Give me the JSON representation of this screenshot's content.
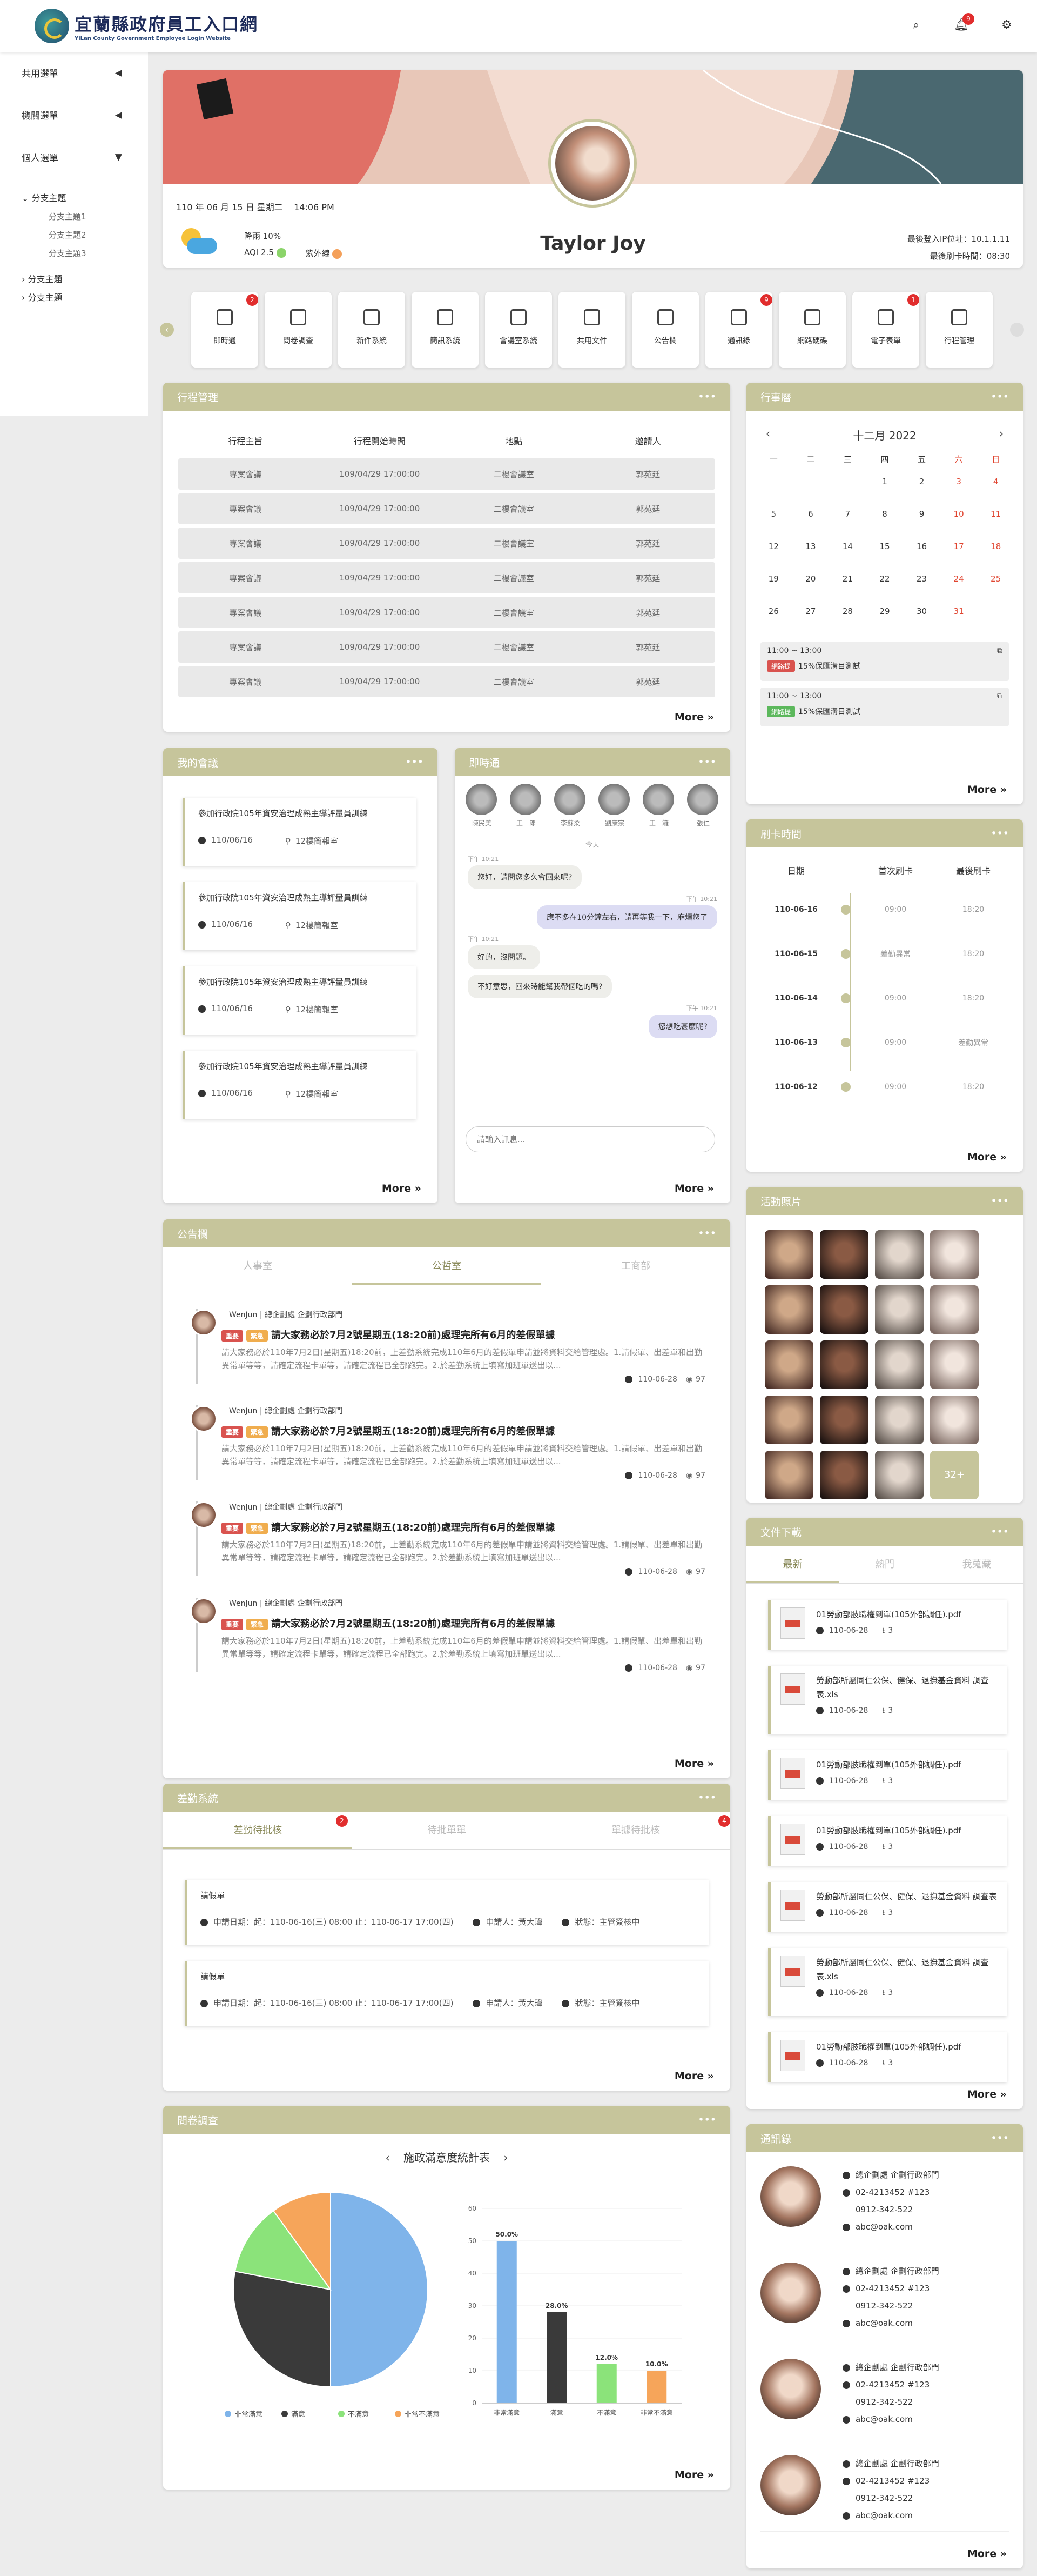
{
  "header": {
    "logo_title": "宜蘭縣政府員工入口網",
    "logo_subtitle": "YiLan County Government Employee Login Website",
    "notif_count": "9"
  },
  "sidebar": {
    "items": [
      {
        "label": "共用選單"
      },
      {
        "label": "機關選單"
      },
      {
        "label": "個人選單"
      }
    ],
    "tree": {
      "root": "分支主題",
      "subs": [
        "分支主題1",
        "分支主題2",
        "分支主題3"
      ],
      "others": [
        "分支主題",
        "分支主題"
      ]
    }
  },
  "profile": {
    "date": "110 年 06 月 15 日 星期二",
    "time": "14:06 PM",
    "rain": "降雨 10%",
    "aqi": "AQI 2.5",
    "uv": "紫外線",
    "name": "Taylor Joy",
    "last_ip": "最後登入IP位址：10.1.1.11",
    "last_punch": "最後刷卡時間：08:30"
  },
  "quick": [
    {
      "label": "即時通",
      "badge": "2",
      "icon": "chat-icon"
    },
    {
      "label": "問卷調查",
      "badge": "",
      "icon": "chart-icon"
    },
    {
      "label": "新件系統",
      "badge": "",
      "icon": "mail-icon"
    },
    {
      "label": "簡訊系統",
      "badge": "",
      "icon": "message-icon"
    },
    {
      "label": "會議室系統",
      "badge": "",
      "icon": "watch-icon"
    },
    {
      "label": "共用文件",
      "badge": "",
      "icon": "document-icon"
    },
    {
      "label": "公告欄",
      "badge": "",
      "icon": "window-icon"
    },
    {
      "label": "通訊錄",
      "badge": "9",
      "icon": "contact-icon"
    },
    {
      "label": "網路硬碟",
      "badge": "",
      "icon": "drive-icon"
    },
    {
      "label": "電子表單",
      "badge": "1",
      "icon": "list-icon"
    },
    {
      "label": "行程管理",
      "badge": "",
      "icon": "calendar-icon"
    }
  ],
  "schedule": {
    "title": "行程管理",
    "headers": [
      "行程主旨",
      "行程開始時間",
      "地點",
      "邀請人"
    ],
    "row": [
      "專案會議",
      "109/04/29 17:00:00",
      "二樓會議室",
      "郭苑廷"
    ],
    "row_count": "7",
    "more": "More"
  },
  "calendar": {
    "title": "行事曆",
    "month": "十二月 2022",
    "weekdays": [
      "一",
      "二",
      "三",
      "四",
      "五",
      "六",
      "日"
    ],
    "weeks": [
      [
        "",
        "",
        "",
        "1",
        "2",
        "3",
        "4"
      ],
      [
        "5",
        "6",
        "7",
        "8",
        "9",
        "10",
        "11"
      ],
      [
        "12",
        "13",
        "14",
        "15",
        "16",
        "17",
        "18"
      ],
      [
        "19",
        "20",
        "21",
        "22",
        "23",
        "24",
        "25"
      ],
      [
        "26",
        "27",
        "28",
        "29",
        "30",
        "31",
        ""
      ]
    ],
    "events": [
      {
        "time": "11:00 ~ 13:00",
        "tag": "網路提",
        "tag_color": "#d9534f",
        "text": "15%保匯溝目測試"
      },
      {
        "time": "11:00 ~ 13:00",
        "tag": "網路提",
        "tag_color": "#5cb85c",
        "text": "15%保匯溝目測試"
      }
    ],
    "more": "More"
  },
  "meetings": {
    "title": "我的會議",
    "item": {
      "title": "參加行政院105年資安治理成熟主導評量員訓練",
      "date": "110/06/16",
      "room": "12樓簡報室"
    },
    "more": "More"
  },
  "chat": {
    "title": "即時通",
    "users": [
      "陳民美",
      "王一郎",
      "李蘇柔",
      "劉康宗",
      "王一籬",
      "張仁"
    ],
    "today": "今天",
    "messages": [
      {
        "side": "left",
        "time": "下午 10:21",
        "text": "您好，請問您多久會回來呢?"
      },
      {
        "side": "right",
        "time": "下午 10:21",
        "text": "應不多在10分鐘左右，請再等我一下，麻煩您了"
      },
      {
        "side": "left",
        "time": "下午 10:21",
        "text": "好的，沒問題。"
      },
      {
        "side": "left",
        "time": "",
        "text": "不好意思，回來時能幫我帶個吃的嗎?"
      },
      {
        "side": "right",
        "time": "下午 10:21",
        "text": "您想吃甚麼呢?"
      }
    ],
    "placeholder": "請輸入訊息...",
    "more": "More"
  },
  "punch": {
    "title": "刷卡時間",
    "headers": [
      "日期",
      "首次刷卡",
      "最後刷卡"
    ],
    "rows": [
      {
        "date": "110-06-16",
        "first": "09:00",
        "last": "18:20"
      },
      {
        "date": "110-06-15",
        "first": "差勤異常",
        "last": "18:20"
      },
      {
        "date": "110-06-14",
        "first": "09:00",
        "last": "18:20"
      },
      {
        "date": "110-06-13",
        "first": "09:00",
        "last": "差勤異常"
      },
      {
        "date": "110-06-12",
        "first": "09:00",
        "last": "18:20"
      }
    ],
    "more": "More"
  },
  "photos": {
    "title": "活動照片",
    "more_count": "32+"
  },
  "announce": {
    "title": "公告欄",
    "tabs": [
      "人事室",
      "公哲室",
      "工商部"
    ],
    "author": "WenJun | 總企劃處 企劃行政部門",
    "tag1": "重要",
    "tag2": "緊急",
    "headline": "請大家務必於7月2號星期五(18:20前)處理完所有6月的差假單據",
    "body": "請大家務必於110年7月2日(星期五)18:20前，上差勤系統完成110年6月的差假單申請並將資料交給管理處。1.請假單、出差單和出勤異常單等等，請確定流程卡單等，請確定流程已全部跑完。2.於差勤系統上填寫加班單送出以...",
    "date": "110-06-28",
    "views": "97",
    "more": "More"
  },
  "attendance": {
    "title": "差勤系統",
    "tabs": [
      {
        "label": "差勤待批核",
        "badge": "2"
      },
      {
        "label": "待批單單",
        "badge": ""
      },
      {
        "label": "單據待批核",
        "badge": "4"
      }
    ],
    "form_title": "請假單",
    "form_date": "申請日期：起：110-06-16(三) 08:00 止：110-06-17 17:00(四)",
    "applicant": "申請人：黃大瑋",
    "status": "狀態：主管簽核中",
    "more": "More"
  },
  "survey": {
    "title": "問卷調查",
    "chart_title": "施政滿意度統計表",
    "more": "More"
  },
  "chart_data": [
    {
      "type": "pie",
      "categories": [
        "非常滿意",
        "滿意",
        "不滿意",
        "非常不滿意"
      ],
      "values": [
        50,
        28,
        12,
        10
      ],
      "colors": [
        "#7fb4ea",
        "#3a3a3a",
        "#8be37a",
        "#f6a55a"
      ]
    },
    {
      "type": "bar",
      "categories": [
        "非常滿意",
        "滿意",
        "不滿意",
        "非常不滿意"
      ],
      "values": [
        50,
        28,
        12,
        10
      ],
      "labels": [
        "50.0%",
        "28.0%",
        "12.0%",
        "10.0%"
      ],
      "ylim": [
        0,
        60
      ],
      "yticks": [
        "0",
        "10",
        "20",
        "30",
        "40",
        "50",
        "60"
      ],
      "colors": [
        "#7fb4ea",
        "#3a3a3a",
        "#8be37a",
        "#f6a55a"
      ]
    }
  ],
  "downloads": {
    "title": "文件下載",
    "tabs": [
      "最新",
      "熱門",
      "我蒐藏"
    ],
    "items": [
      {
        "name": "01勞動部肢職權到單(105外部調任).pdf"
      },
      {
        "name": "勞動部所屬同仁公保、健保、退撫基金資料 調查表.xls"
      },
      {
        "name": "01勞動部肢職權到單(105外部調任).pdf"
      },
      {
        "name": "01勞動部肢職權到單(105外部調任).pdf"
      },
      {
        "name": "勞動部所屬同仁公保、健保、退撫基金資料 調查表"
      },
      {
        "name": "勞動部所屬同仁公保、健保、退撫基金資料 調查表.xls"
      },
      {
        "name": "01勞動部肢職權到單(105外部調任).pdf"
      }
    ],
    "date": "110-06-28",
    "count": "3",
    "more": "More"
  },
  "contacts": {
    "title": "通訊錄",
    "dept": "總企劃處 企劃行政部門",
    "tel": "02-4213452 #123",
    "mobile": "0912-342-522",
    "email": "abc@oak.com",
    "more": "More"
  }
}
